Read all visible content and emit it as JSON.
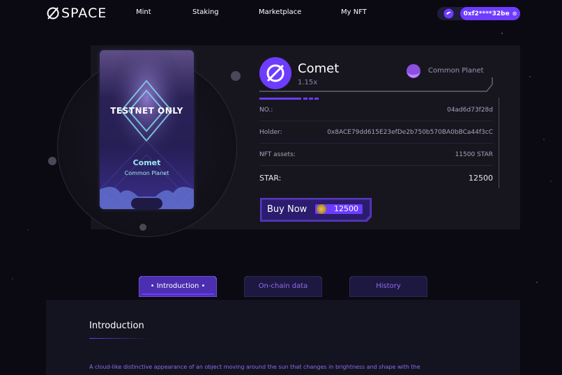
{
  "header": {
    "logo_text": "SPACE",
    "nav": [
      "Mint",
      "Staking",
      "Marketplace",
      "My NFT"
    ],
    "wallet_address": "0xf2****32be"
  },
  "nft_card": {
    "badge": "TESTNET ONLY",
    "name": "Comet",
    "planet_type": "Common Planet"
  },
  "details": {
    "name": "Comet",
    "multiplier": "1.15x",
    "planet_type": "Common Planet",
    "rows": [
      {
        "label": "NO.:",
        "value": "04ad6d73f28d"
      },
      {
        "label": "Holder:",
        "value": "0x8ACE79dd615E23efDe2b750b570BA0bBCa44f3cC"
      },
      {
        "label": "NFT assets:",
        "value": "11500 STAR"
      },
      {
        "label": "STAR:",
        "value": "12500"
      }
    ],
    "buy_label": "Buy Now",
    "buy_price": "12500"
  },
  "tabs": [
    {
      "label": "Introduction",
      "active": true
    },
    {
      "label": "On-chain data",
      "active": false
    },
    {
      "label": "History",
      "active": false
    }
  ],
  "intro": {
    "title": "Introduction",
    "text": "A cloud-like distinctive appearance of an object moving around the sun that changes in brightness and shape with the"
  },
  "colors": {
    "accent": "#6d3cff",
    "background": "#0b0a12",
    "panel": "#17161f",
    "card_text": "#9fe8ee"
  },
  "icons": {
    "logo": "empty-set-logo-icon",
    "wallet": "wallet-logo-icon",
    "copy": "copy-icon",
    "coin": "star-coin-icon",
    "planet": "planet-badge-icon"
  }
}
